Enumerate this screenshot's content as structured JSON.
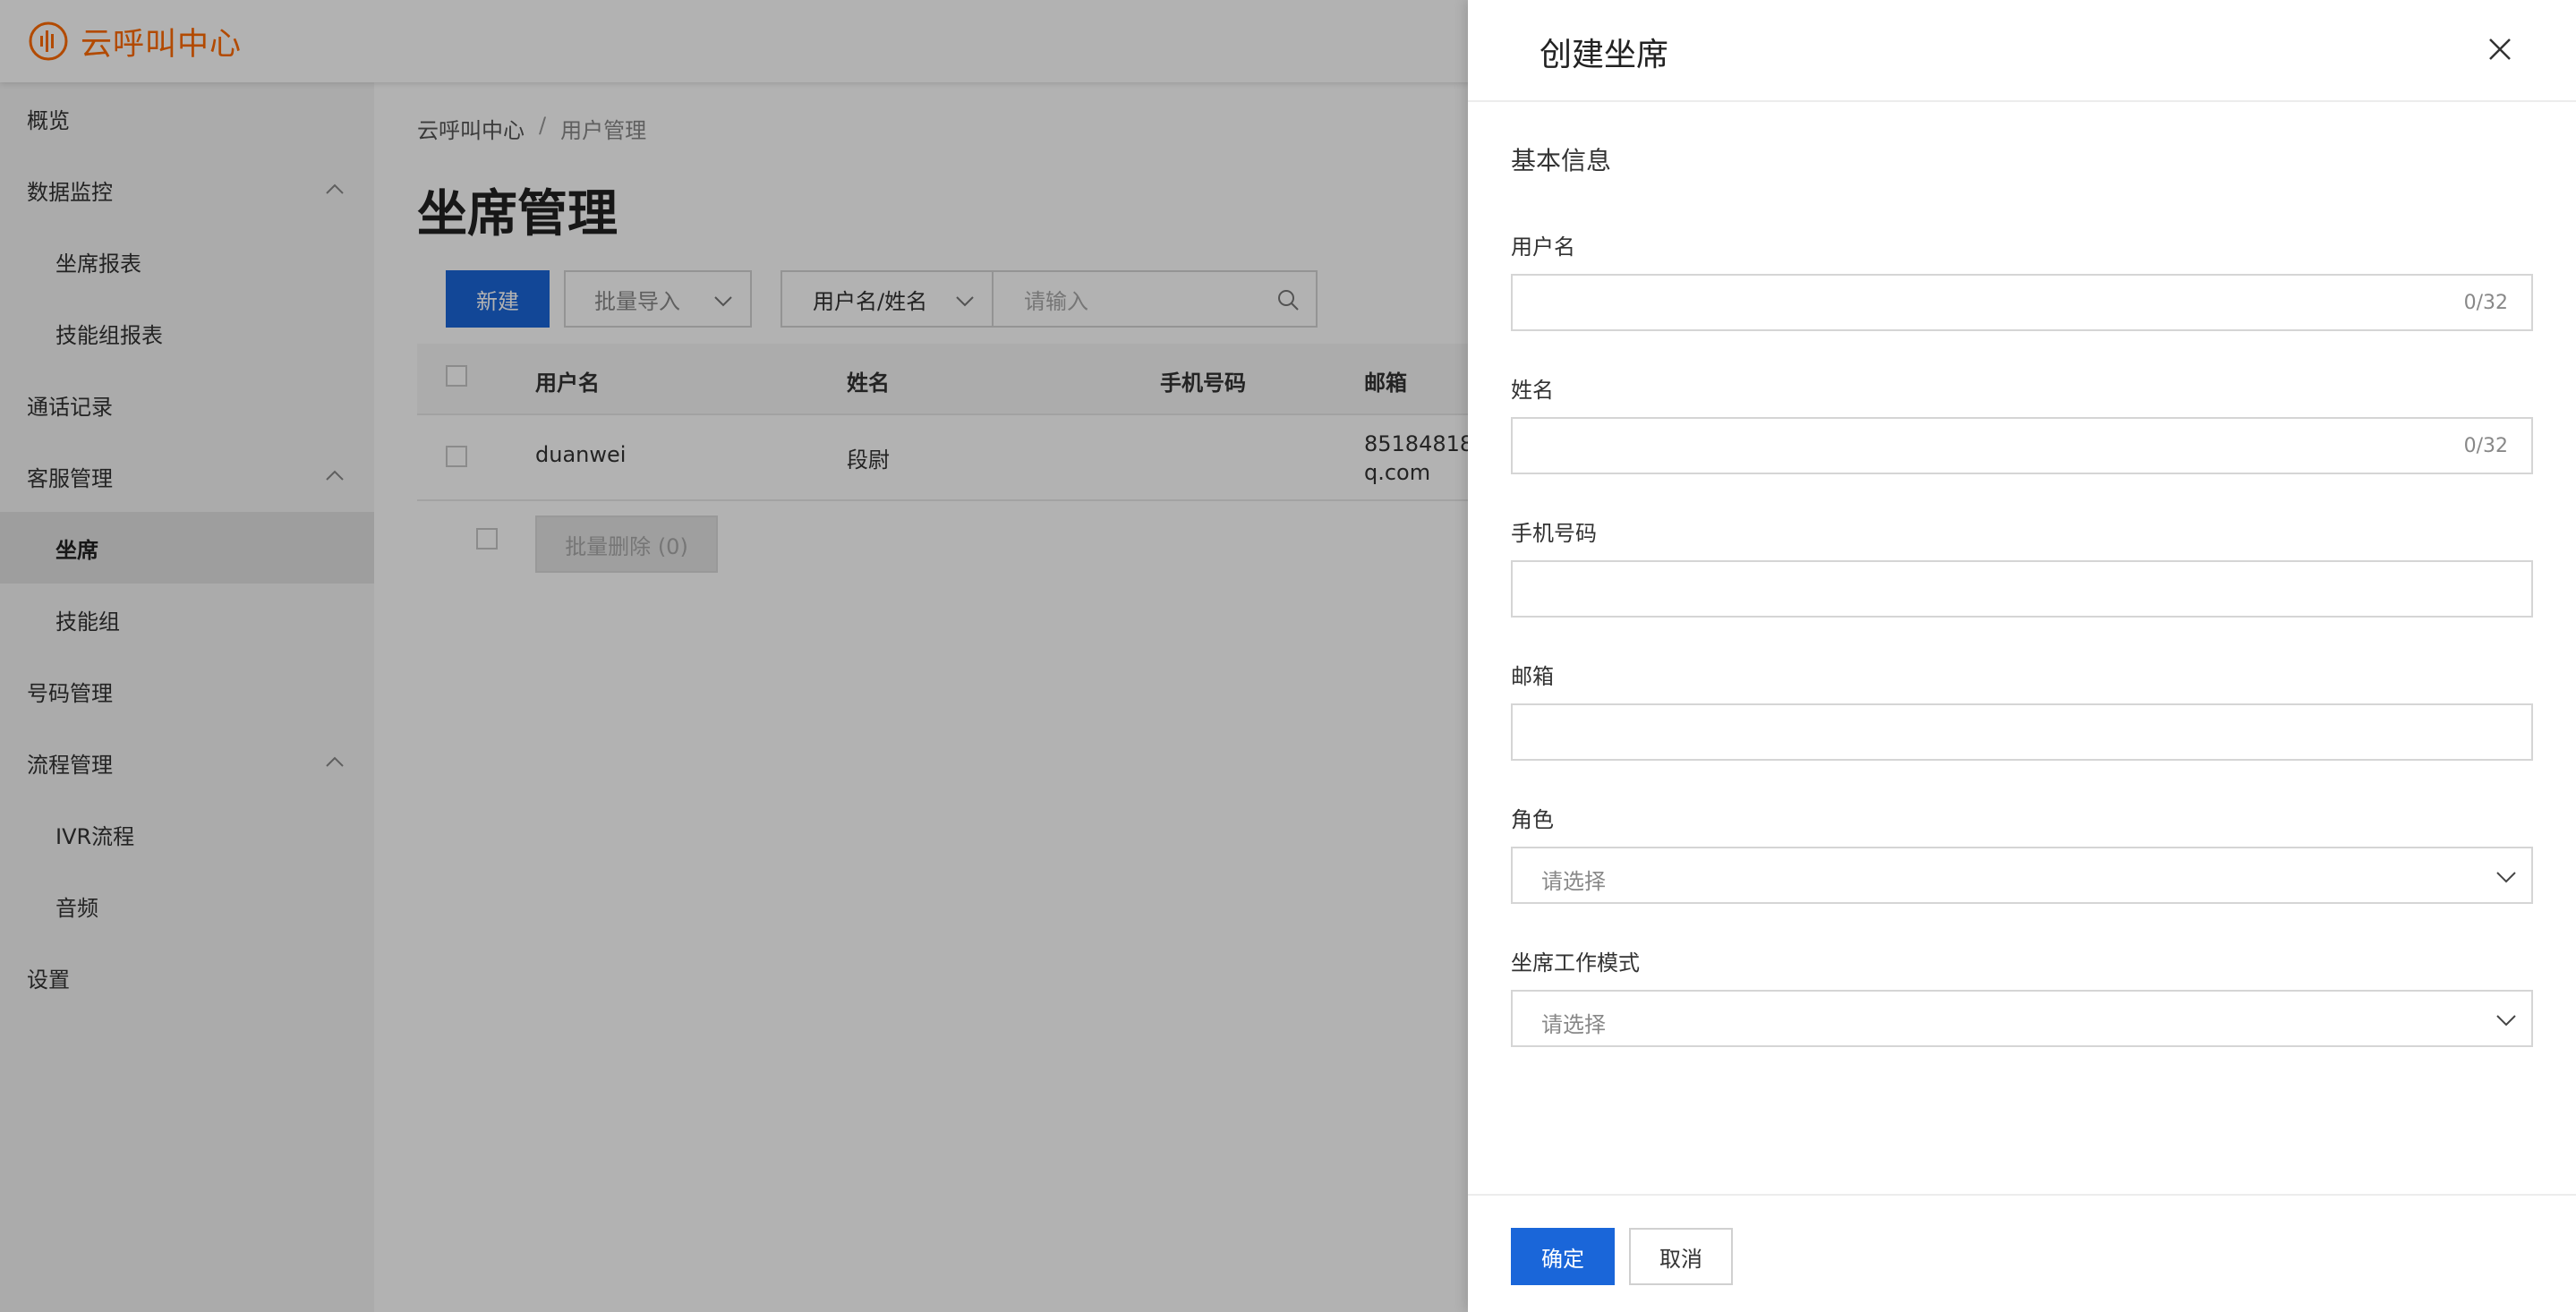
{
  "app": {
    "logo_text": "云呼叫中心",
    "logo_icon": "sound-wave-logo-icon",
    "brand_color": "#ff6a00",
    "accent_color": "#1a66d9"
  },
  "sidebar": {
    "items": [
      {
        "label": "概览",
        "level": 1
      },
      {
        "label": "数据监控",
        "level": 1,
        "expanded": true
      },
      {
        "label": "坐席报表",
        "level": 2
      },
      {
        "label": "技能组报表",
        "level": 2
      },
      {
        "label": "通话记录",
        "level": 1
      },
      {
        "label": "客服管理",
        "level": 1,
        "expanded": true
      },
      {
        "label": "坐席",
        "level": 2,
        "active": true
      },
      {
        "label": "技能组",
        "level": 2
      },
      {
        "label": "号码管理",
        "level": 1
      },
      {
        "label": "流程管理",
        "level": 1,
        "expanded": true
      },
      {
        "label": "IVR流程",
        "level": 2
      },
      {
        "label": "音频",
        "level": 2
      },
      {
        "label": "设置",
        "level": 1
      }
    ]
  },
  "main": {
    "breadcrumb": [
      "云呼叫中心",
      "用户管理"
    ],
    "breadcrumb_sep": "/",
    "page_title": "坐席管理",
    "toolbar": {
      "new_label": "新建",
      "import_label": "批量导入",
      "filter_label": "用户名/姓名",
      "search_placeholder": "请输入"
    },
    "table": {
      "columns": [
        "用户名",
        "姓名",
        "手机号码",
        "邮箱"
      ],
      "rows": [
        {
          "username": "duanwei",
          "name": "段尉",
          "phone": "",
          "email_line1": "85184818",
          "email_line2": "q.com"
        }
      ]
    },
    "batch_delete_label": "批量删除 (0)"
  },
  "drawer": {
    "title": "创建坐席",
    "section": "基本信息",
    "fields": {
      "username": {
        "label": "用户名",
        "counter": "0/32"
      },
      "name": {
        "label": "姓名",
        "counter": "0/32"
      },
      "phone": {
        "label": "手机号码"
      },
      "email": {
        "label": "邮箱"
      },
      "role": {
        "label": "角色",
        "placeholder": "请选择"
      },
      "work_mode": {
        "label": "坐席工作模式",
        "placeholder": "请选择"
      }
    },
    "ok_label": "确定",
    "cancel_label": "取消"
  }
}
